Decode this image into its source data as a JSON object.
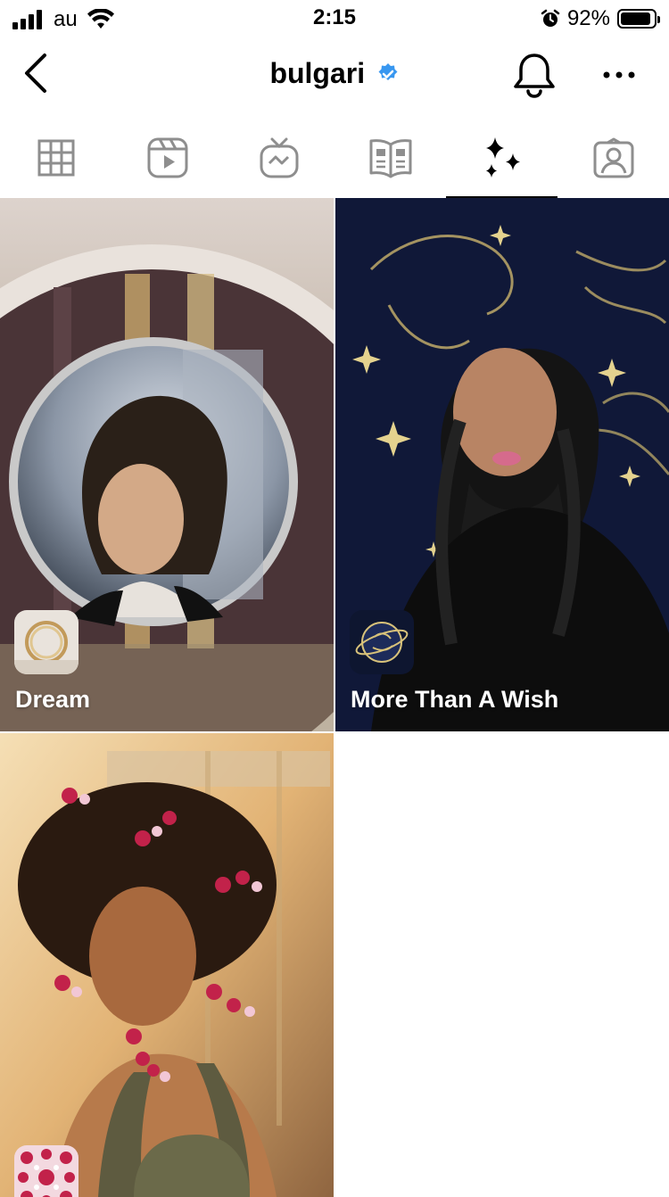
{
  "status_bar": {
    "carrier": "au",
    "time": "2:15",
    "battery_percent_text": "92%",
    "battery_level": 0.92
  },
  "header": {
    "title": "bulgari",
    "verified_color": "#3897f0"
  },
  "tabs": [
    {
      "name": "grid-icon",
      "active": false
    },
    {
      "name": "reels-icon",
      "active": false
    },
    {
      "name": "igtv-icon",
      "active": false
    },
    {
      "name": "guides-icon",
      "active": false
    },
    {
      "name": "effects-sparkle-icon",
      "active": true
    },
    {
      "name": "tagged-icon",
      "active": false
    }
  ],
  "effects": [
    {
      "label": "Dream",
      "thumb_icon": "ring-thumbnail"
    },
    {
      "label": "More Than A Wish",
      "thumb_icon": "zodiac-globe-thumbnail"
    },
    {
      "label": "",
      "thumb_icon": "flower-pattern-thumbnail"
    }
  ]
}
